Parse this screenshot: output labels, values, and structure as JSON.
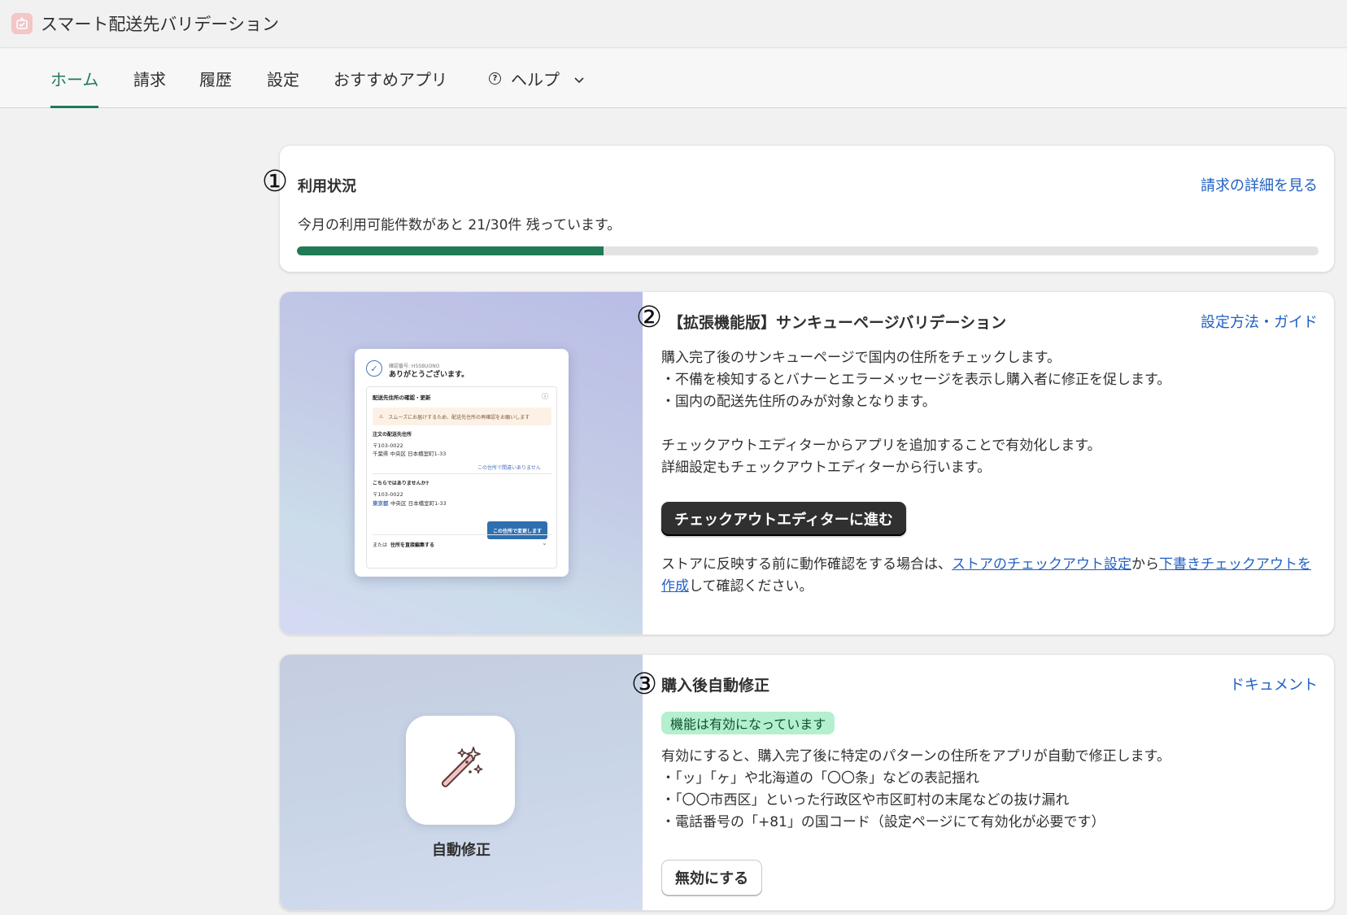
{
  "app": {
    "title": "スマート配送先バリデーション",
    "icon": "app-logo-icon"
  },
  "nav": {
    "tabs": [
      {
        "label": "ホーム",
        "active": true
      },
      {
        "label": "請求",
        "active": false
      },
      {
        "label": "履歴",
        "active": false
      },
      {
        "label": "設定",
        "active": false
      },
      {
        "label": "おすすめアプリ",
        "active": false
      }
    ],
    "help": {
      "label": "ヘルプ",
      "icon": "help-circle-icon",
      "chevron": "chevron-down-icon"
    }
  },
  "usage": {
    "badge": "1",
    "title": "利用状況",
    "link": "請求の詳細を見る",
    "text": "今月の利用可能件数があと 21/30件 残っています。",
    "progress_used_fraction": 0.3,
    "progress_color": "#1f7a55"
  },
  "thankyou": {
    "badge": "2",
    "title": "【拡張機能版】サンキューページバリデーション",
    "link": "設定方法・ガイド",
    "lines": [
      "購入完了後のサンキューページで国内の住所をチェックします。",
      "・不備を検知するとバナーとエラーメッセージを表示し購入者に修正を促します。",
      "・国内の配送先住所のみが対象となります。",
      "チェックアウトエディターからアプリを追加することで有効化します。",
      "詳細設定もチェックアウトエディターから行います。"
    ],
    "button": "チェックアウトエディターに進む",
    "note_before": "ストアに反映する前に動作確認をする場合は、",
    "note_link1": "ストアのチェックアウト設定",
    "note_mid": "から",
    "note_link2": "下書きチェックアウトを作成",
    "note_after": "して確認ください。",
    "preview": {
      "order_no": "確認番号: H5SBUONO",
      "thanks": "ありがとうございます。",
      "section": "配送先住所の確認・更新",
      "warning": "スムーズにお届けするため、配送先住所の再確認をお願いします",
      "addr_heading": "注文の配送先住所",
      "addr_zip": "〒103-0022",
      "addr_line": "千葉県 中央区 日本橋室町1-33",
      "addr_link": "この住所で間違いありません",
      "suggest_heading": "こちらではありませんか?",
      "suggest_zip": "〒103-0022",
      "suggest_pref": "東京都",
      "suggest_line": "中央区 日本橋室町1-33",
      "suggest_button": "この住所で変更します",
      "footer_or": "または",
      "footer_edit": "住所を直接編集する"
    }
  },
  "autofix": {
    "badge": "3",
    "title": "購入後自動修正",
    "link": "ドキュメント",
    "tile_label": "自動修正",
    "tile_icon": "magic-wand-icon",
    "status": "機能は有効になっています",
    "lines": [
      "有効にすると、購入完了後に特定のパターンの住所をアプリが自動で修正します。",
      "・「ッ」「ヶ」や北海道の「〇〇条」などの表記揺れ",
      "・「〇〇市西区」といった行政区や市区町村の末尾などの抜け漏れ",
      "・電話番号の「+81」の国コード（設定ページにて有効化が必要です）"
    ],
    "button": "無効にする"
  }
}
